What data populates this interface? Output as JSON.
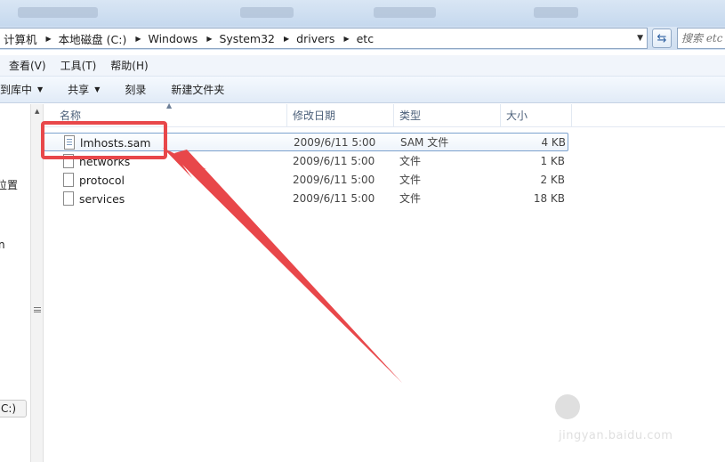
{
  "address_bar": {
    "crumbs": [
      "计算机",
      "本地磁盘 (C:)",
      "Windows",
      "System32",
      "drivers",
      "etc"
    ],
    "search_placeholder": "搜索 etc"
  },
  "menu": [
    "查看(V)",
    "工具(T)",
    "帮助(H)"
  ],
  "toolbar": {
    "include_library": "到库中",
    "share": "共享",
    "burn": "刻录",
    "new_folder": "新建文件夹"
  },
  "nav_pane": {
    "fragment_1": "位置",
    "fragment_2": "n",
    "drive": "C:)"
  },
  "columns": {
    "name": "名称",
    "date": "修改日期",
    "type": "类型",
    "size": "大小"
  },
  "files": [
    {
      "name": "lmhosts.sam",
      "date": "2009/6/11 5:00",
      "type": "SAM 文件",
      "size": "4 KB",
      "icon": "document-icon",
      "selected": true
    },
    {
      "name": "networks",
      "date": "2009/6/11 5:00",
      "type": "文件",
      "size": "1 KB",
      "icon": "file-icon",
      "selected": false
    },
    {
      "name": "protocol",
      "date": "2009/6/11 5:00",
      "type": "文件",
      "size": "2 KB",
      "icon": "file-icon",
      "selected": false
    },
    {
      "name": "services",
      "date": "2009/6/11 5:00",
      "type": "文件",
      "size": "18 KB",
      "icon": "file-icon",
      "selected": false
    }
  ],
  "annotation": {
    "color": "#e8474a"
  },
  "watermark": {
    "logo": "Bai du 经验",
    "url": "jingyan.baidu.com"
  }
}
